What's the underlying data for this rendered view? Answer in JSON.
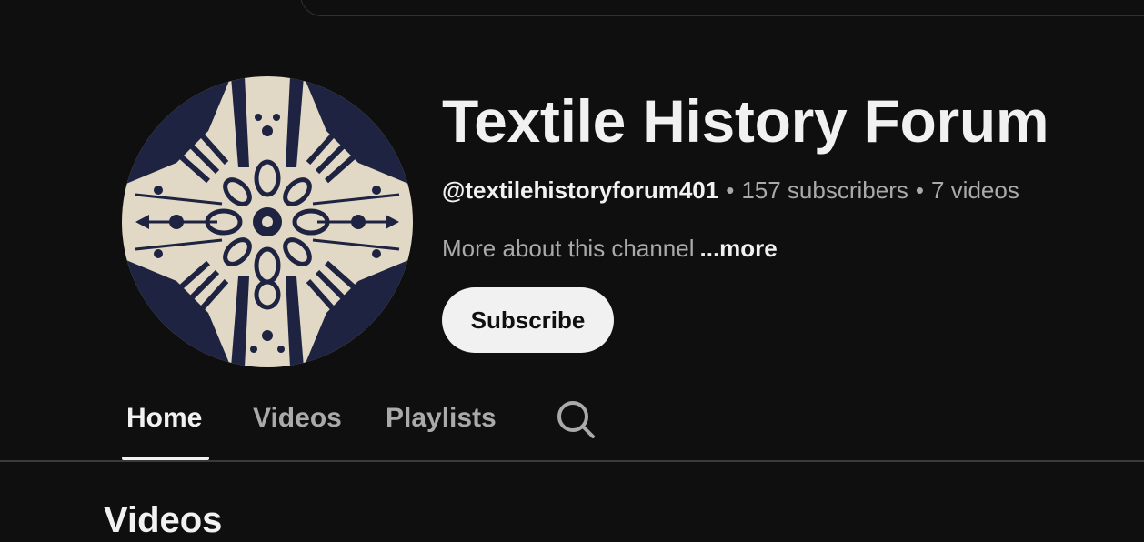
{
  "channel": {
    "title": "Textile History Forum",
    "handle": "@textilehistoryforum401",
    "separator": "•",
    "subscribers": "157 subscribers",
    "videos": "7 videos",
    "about": "More about this channel",
    "more_label": "...more",
    "avatar_icon": "textile-pattern-avatar"
  },
  "actions": {
    "subscribe_label": "Subscribe"
  },
  "tabs": [
    {
      "label": "Home",
      "active": true
    },
    {
      "label": "Videos",
      "active": false
    },
    {
      "label": "Playlists",
      "active": false
    }
  ],
  "tab_search_icon": "search-icon",
  "section": {
    "heading": "Videos"
  },
  "colors": {
    "background": "#0f0f0f",
    "primary_text": "#f1f1f1",
    "secondary_text": "#aaaaaa",
    "avatar_light": "#e2d8c6",
    "avatar_dark": "#1d2340"
  }
}
